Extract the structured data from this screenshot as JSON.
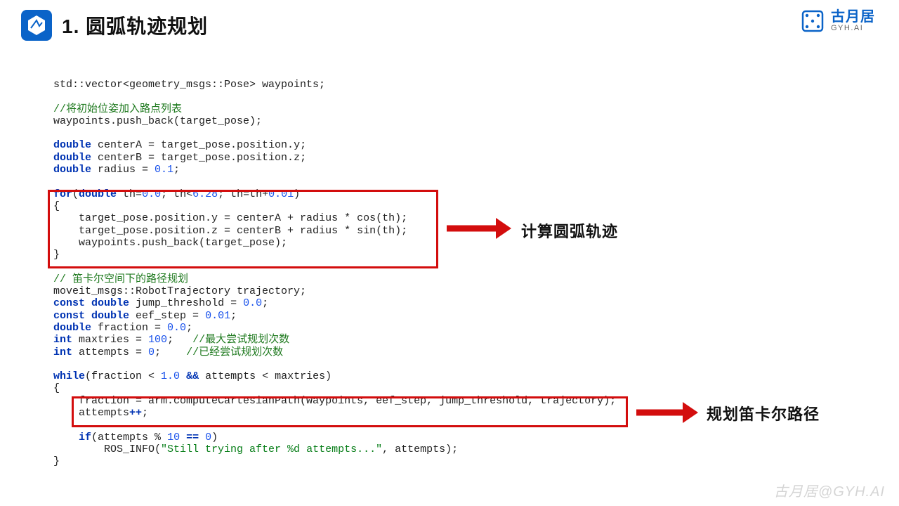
{
  "header": {
    "title": "1. 圆弧轨迹规划",
    "brand_cn": "古月居",
    "brand_en": "GYH.AI"
  },
  "code": {
    "l01": "std::vector<geometry_msgs::Pose> waypoints;",
    "l03_cm": "//将初始位姿加入路点列表",
    "l04": "waypoints.push_back(target_pose);",
    "l06_kw": "double",
    "l06a": " centerA = target_pose.position.y;",
    "l07_kw": "double",
    "l07a": " centerB = target_pose.position.z;",
    "l08_kw": "double",
    "l08a": " radius = ",
    "l08_n": "0.1",
    "l08b": ";",
    "l10_for": "for",
    "l10_kw": "double",
    "l10a": "(",
    "l10b": " th=",
    "l10_n1": "0.0",
    "l10c": "; th<",
    "l10_n2": "6.28",
    "l10d": "; th=th+",
    "l10_n3": "0.01",
    "l10e": ")",
    "l11": "{",
    "l12": "    target_pose.position.y = centerA + radius * cos(th);",
    "l13": "    target_pose.position.z = centerB + radius * sin(th);",
    "l14": "    waypoints.push_back(target_pose);",
    "l15": "}",
    "l17_cm": "// 笛卡尔空间下的路径规划",
    "l18": "moveit_msgs::RobotTrajectory trajectory;",
    "l19_kw1": "const",
    "l19_kw2": "double",
    "l19a": " jump_threshold = ",
    "l19_n": "0.0",
    "l19b": ";",
    "l20_kw1": "const",
    "l20_kw2": "double",
    "l20a": " eef_step = ",
    "l20_n": "0.01",
    "l20b": ";",
    "l21_kw": "double",
    "l21a": " fraction = ",
    "l21_n": "0.0",
    "l21b": ";",
    "l22_kw": "int",
    "l22a": " maxtries = ",
    "l22_n": "100",
    "l22b": ";   ",
    "l22_cm": "//最大尝试规划次数",
    "l23_kw": "int",
    "l23a": " attempts = ",
    "l23_n": "0",
    "l23b": ";    ",
    "l23_cm": "//已经尝试规划次数",
    "l25_while": "while",
    "l25a": "(fraction < ",
    "l25_n": "1.0",
    "l25_and": " && ",
    "l25b": "attempts < maxtries)",
    "l26": "{",
    "l27": "    fraction = arm.computeCartesianPath(waypoints, eef_step, jump_threshold, trajectory);",
    "l28a": "    attempts",
    "l28_op": "++",
    "l28b": ";",
    "l30_kw": "if",
    "l30a": "    ",
    "l30b": "(attempts % ",
    "l30_n1": "10",
    "l30_eq": " == ",
    "l30_n2": "0",
    "l30c": ")",
    "l31a": "        ROS_INFO(",
    "l31_s": "\"Still trying after %d attempts...\"",
    "l31b": ", attempts);",
    "l32": "}"
  },
  "annotations": {
    "a1": "计算圆弧轨迹",
    "a2": "规划笛卡尔路径"
  },
  "watermark": "古月居@GYH.AI"
}
